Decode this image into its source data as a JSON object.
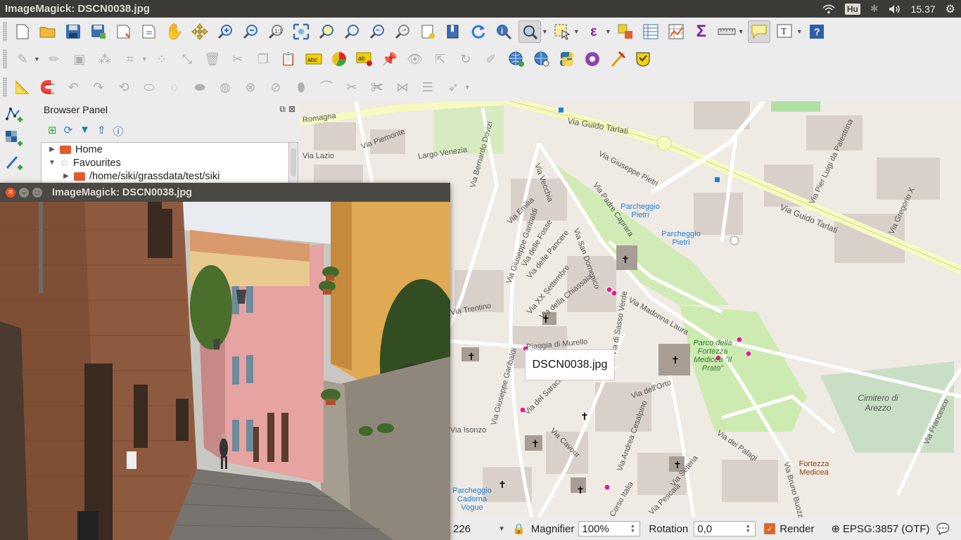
{
  "topbar": {
    "title": "ImageMagick: DSCN0038.jpg",
    "keyboard": "Hu",
    "time": "15.37"
  },
  "toolbars": {
    "row1": [
      "new-project",
      "open-project",
      "save-project",
      "save-as",
      "new-print-layout",
      "layout-manager",
      "pan",
      "pan-to-selection",
      "zoom-in",
      "zoom-out",
      "zoom-native",
      "zoom-full",
      "zoom-to-selection",
      "zoom-to-layer",
      "zoom-last",
      "zoom-next",
      "new-bookmark",
      "show-bookmarks",
      "refresh",
      "identify",
      "map-tips",
      "select-features",
      "expression-select",
      "deselect",
      "attribute-table",
      "statistics",
      "field-calculator",
      "measure",
      "annotation",
      "text-annotation",
      "help"
    ],
    "row2": [
      "digitize",
      "edit-pencil",
      "save-edits",
      "add-feature",
      "vertex-tool",
      "delete-selected",
      "cut-features",
      "copy-features",
      "paste-features",
      "labeling",
      "diagram",
      "layer-labeling",
      "pin-labels",
      "show-hide-labels",
      "move-label",
      "rotate-label",
      "change-label",
      "add-wms",
      "add-wfs",
      "python-console",
      "plugin",
      "grass-tools",
      "magic-tool"
    ],
    "row3": [
      "advanced-digitize",
      "snap",
      "undo",
      "redo",
      "rotate-feature",
      "simplify",
      "add-ring",
      "add-part",
      "fill-ring",
      "delete-ring",
      "delete-part",
      "reshape",
      "offset-curve",
      "split-features",
      "split-parts",
      "merge",
      "merge-attributes",
      "rotate-point",
      "offset-point"
    ]
  },
  "browser": {
    "title": "Browser Panel",
    "items": [
      {
        "label": "Home",
        "type": "folder",
        "expanded": false
      },
      {
        "label": "Favourites",
        "type": "star",
        "expanded": true
      },
      {
        "label": "/home/siki/grassdata/test/siki",
        "type": "folder",
        "expanded": false
      }
    ]
  },
  "imagewindow": {
    "title": "ImageMagick: DSCN0038.jpg"
  },
  "map": {
    "tooltip": "DSCN0038.jpg",
    "labels": [
      "Via Guido Tarlati",
      "Via Guido Tarlati",
      "Romagna",
      "Via Piemonte",
      "Largo Venezia",
      "Via Lazio",
      "Via Bernardo Dovizi",
      "Via Vecchia",
      "Via Giuseppe Pietri",
      "Via Pier Luigi da Palestrina",
      "Via Gregorio X",
      "Parcheggio Pietri",
      "Parcheggio Pietri",
      "Via Padre Caprara",
      "Via San Domenico",
      "Via Giuseppe Garibaldi",
      "Via delle Fosse",
      "Via delle Pancere",
      "Via XX Settembre",
      "Via della Chiassaia",
      "Via di Sasso Verde",
      "Via Madonna Laura",
      "Piaggia di Murello",
      "Parco della Fortezza Medicea \"Il Prato\"",
      "Cimitero di Arezzo",
      "Via Francesco",
      "Via del Saracino",
      "Via Giuseppe Garibaldi",
      "Via dell'Orto",
      "Via Andrea Cesalpino",
      "Via Cavour",
      "Via dei Palagi",
      "Fortezza Medicea",
      "Via Bruno Buozzi",
      "Via Seteria",
      "Via Pescaia",
      "Corso Italia",
      "Parcheggio Cadorna Vogue",
      "Via Emilia",
      "Via Trentino",
      "Via Isonzo"
    ]
  },
  "status": {
    "scale_value": "226",
    "magnifier_label": "Magnifier",
    "magnifier_value": "100%",
    "rotation_label": "Rotation",
    "rotation_value": "0,0",
    "render_label": "Render",
    "crs": "EPSG:3857 (OTF)"
  }
}
